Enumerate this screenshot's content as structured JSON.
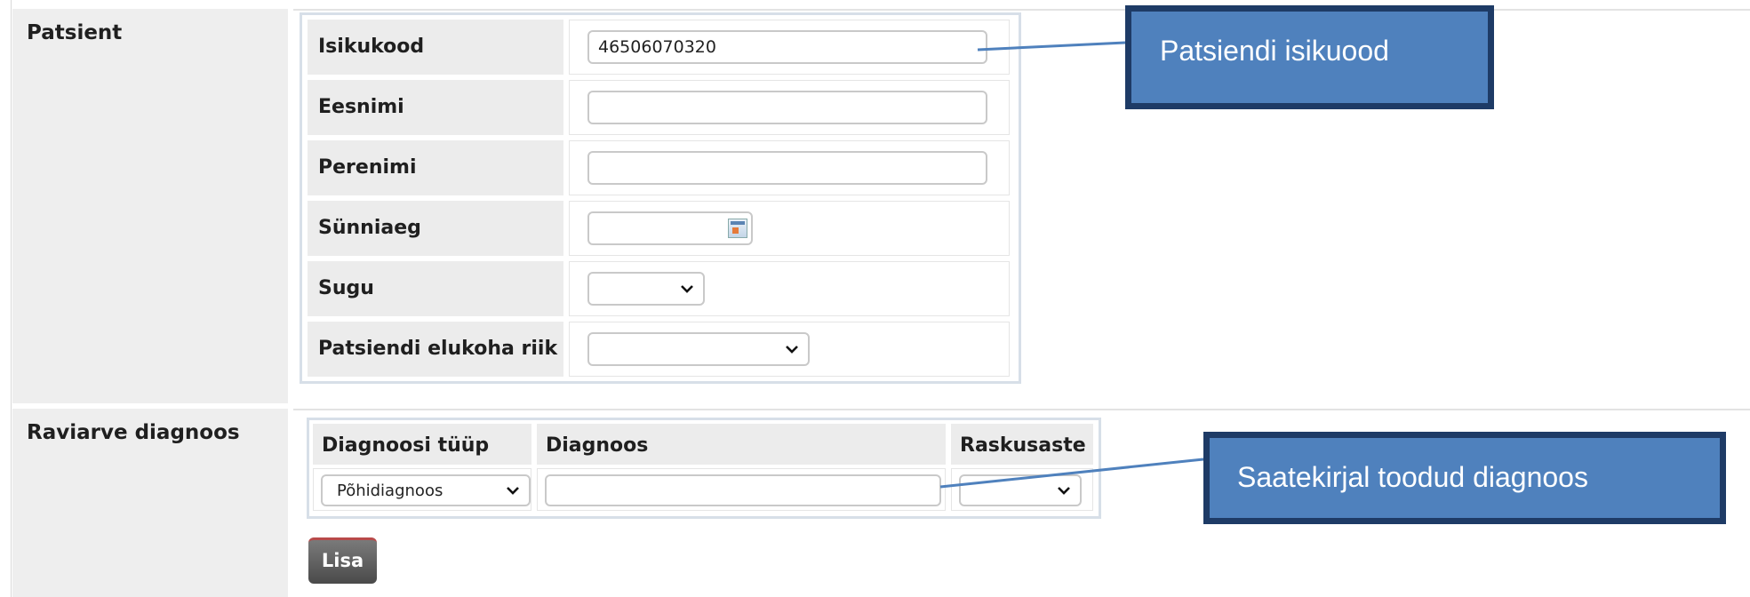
{
  "patient_section": {
    "title": "Patsient",
    "fields": [
      {
        "label": "Isikukood",
        "type": "text",
        "value": "46506070320"
      },
      {
        "label": "Eesnimi",
        "type": "text",
        "value": ""
      },
      {
        "label": "Perenimi",
        "type": "text",
        "value": ""
      },
      {
        "label": "Sünniaeg",
        "type": "date",
        "value": "",
        "icon": "calendar-icon"
      },
      {
        "label": "Sugu",
        "type": "select",
        "value": ""
      },
      {
        "label": "Patsiendi elukoha riik",
        "type": "select",
        "value": ""
      }
    ]
  },
  "diagnosis_section": {
    "title": "Raviarve diagnoos",
    "columns": [
      "Diagnoosi tüüp",
      "Diagnoos",
      "Raskusaste"
    ],
    "row": {
      "type": "Põhidiagnoos",
      "diagnosis": "",
      "severity": ""
    },
    "add_button": "Lisa"
  },
  "callouts": {
    "personal_code": "Patsiendi isikuood",
    "diagnosis": "Saatekirjal  toodud diagnoos"
  },
  "colors": {
    "callout_fill": "#4f81bd",
    "callout_border": "#1e3b66",
    "label_bg": "#ececec"
  }
}
